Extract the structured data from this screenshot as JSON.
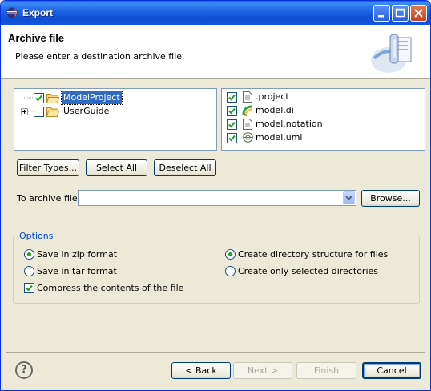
{
  "window": {
    "title": "Export"
  },
  "banner": {
    "title": "Archive file",
    "subtitle": "Please enter a destination archive file."
  },
  "tree": {
    "items": [
      {
        "label": "ModelProject",
        "checked": true,
        "selected": true
      },
      {
        "label": "UserGuide",
        "checked": false,
        "selected": false
      }
    ]
  },
  "files": {
    "items": [
      {
        "label": ".project",
        "checked": true,
        "icon": "text-file-icon"
      },
      {
        "label": "model.di",
        "checked": true,
        "icon": "diagram-file-icon"
      },
      {
        "label": "model.notation",
        "checked": true,
        "icon": "text-file-icon"
      },
      {
        "label": "model.uml",
        "checked": true,
        "icon": "uml-file-icon"
      }
    ]
  },
  "buttons": {
    "filter_types": "Filter Types...",
    "select_all": "Select All",
    "deselect_all": "Deselect All",
    "browse": "Browse...",
    "back": "< Back",
    "next": "Next >",
    "finish": "Finish",
    "cancel": "Cancel"
  },
  "archive": {
    "label": "To archive file:",
    "value": ""
  },
  "options": {
    "legend": "Options",
    "zip": "Save in zip format",
    "tar": "Save in tar format",
    "compress": "Compress the contents of the file",
    "dir_structure": "Create directory structure for files",
    "selected_dirs": "Create only selected directories",
    "format_selected": "zip",
    "structure_selected": "dir_structure",
    "compress_checked": true
  },
  "colors": {
    "titlebar": "#0a5fe8",
    "selection": "#316ac5",
    "group_legend": "#0046d5",
    "radio_dot": "#21a121",
    "checkmark": "#21a121"
  }
}
